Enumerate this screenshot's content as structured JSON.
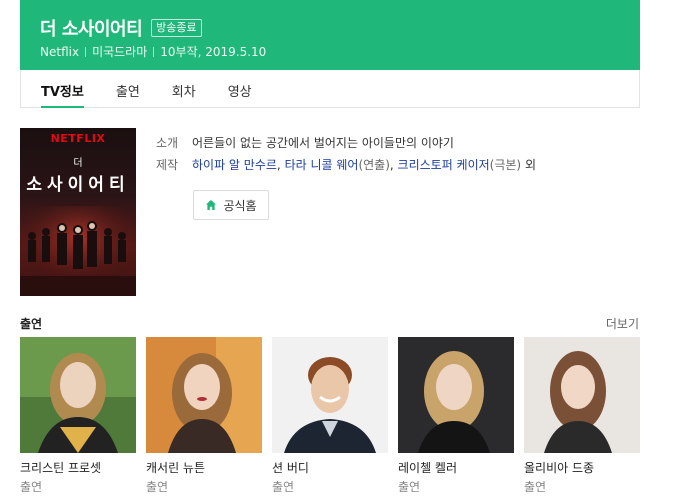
{
  "header": {
    "title": "더 소사이어티",
    "badge": "방송종료",
    "meta": [
      "Netflix",
      "미국드라마",
      "10부작, 2019.5.10"
    ]
  },
  "tabs": [
    {
      "label": "TV정보",
      "active": true
    },
    {
      "label": "출연",
      "active": false
    },
    {
      "label": "회차",
      "active": false
    },
    {
      "label": "영상",
      "active": false
    }
  ],
  "poster": {
    "brand": "NETFLIX",
    "title_small": "더",
    "title_large": "소사이어티"
  },
  "info": {
    "intro_label": "소개",
    "intro_text": "어른들이 없는 공간에서 벌어지는 아이들만의 이야기",
    "staff_label": "제작",
    "staff": [
      {
        "name": "하이파 알 만수르",
        "role": ""
      },
      {
        "name": "타라 니콜 웨어",
        "role": "(연출)"
      },
      {
        "name": "크리스토퍼 케이저",
        "role": "(극본)"
      }
    ],
    "staff_suffix": "외",
    "home_button": "공식홈"
  },
  "cast_section": {
    "title": "출연",
    "more": "더보기",
    "members": [
      {
        "name": "크리스틴 프로셋",
        "role": "출연"
      },
      {
        "name": "캐서린 뉴튼",
        "role": "출연"
      },
      {
        "name": "션 버디",
        "role": "출연"
      },
      {
        "name": "레이첼 켈러",
        "role": "출연"
      },
      {
        "name": "올리비아 드종",
        "role": "출연"
      }
    ]
  },
  "colors": {
    "brand_green": "#1fb87a",
    "link_blue": "#1b3d9c",
    "netflix_red": "#e50914"
  },
  "icons": {
    "home_button": "house-icon"
  }
}
